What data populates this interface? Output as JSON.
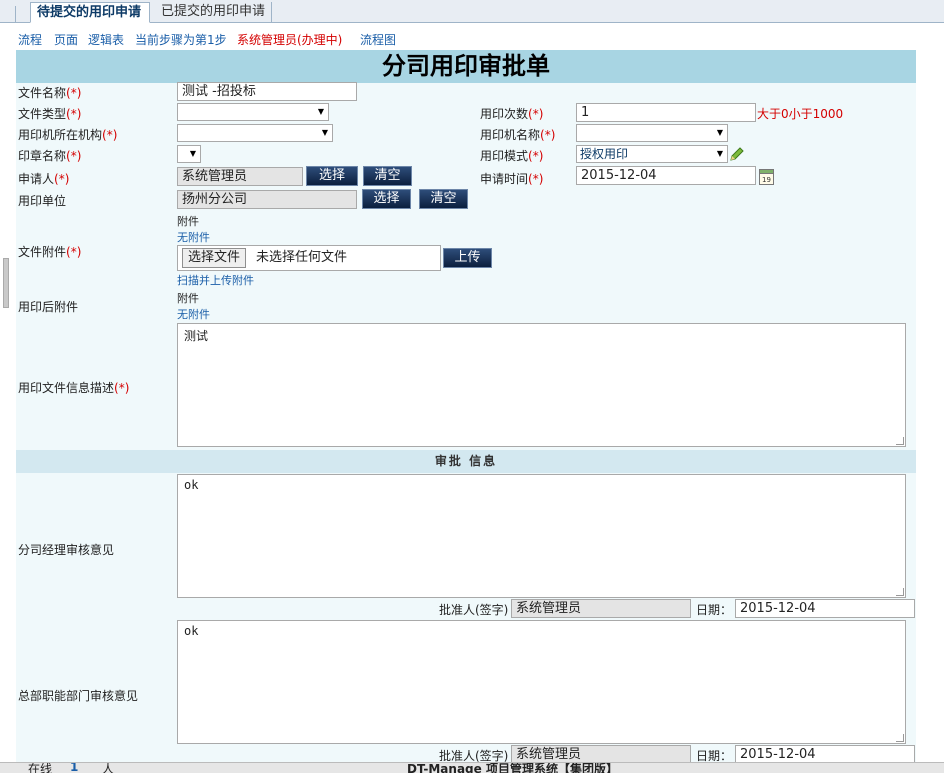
{
  "tabs": {
    "active": "待提交的用印申请",
    "inactive": "已提交的用印申请"
  },
  "toolbar": {
    "flow": "流程",
    "page": "页面",
    "logic": "逻辑表",
    "step": "当前步骤为第1步",
    "handler": "系统管理员(办理中)",
    "flowchart": "流程图"
  },
  "form": {
    "title": "分司用印审批单",
    "file_name": {
      "label": "文件名称",
      "value": "测试 -招投标"
    },
    "file_type": {
      "label": "文件类型",
      "value": ""
    },
    "use_count": {
      "label": "用印次数",
      "value": "1",
      "hint": "大于0小于1000"
    },
    "machine_org": {
      "label": "用印机所在机构",
      "value": ""
    },
    "machine_name": {
      "label": "用印机名称",
      "value": ""
    },
    "seal_name": {
      "label": "印章名称",
      "value": ""
    },
    "mode": {
      "label": "用印模式",
      "value": "授权用印"
    },
    "applicant": {
      "label": "申请人",
      "value": "系统管理员"
    },
    "apply_time": {
      "label": "申请时间",
      "value": "2015-12-04"
    },
    "unit": {
      "label": "用印单位",
      "value": "扬州分公司"
    },
    "select_label": "选择",
    "clear_label": "清空",
    "attachment": {
      "label": "文件附件",
      "caption": "附件",
      "none": "无附件",
      "choose": "选择文件",
      "no_file": "未选择任何文件",
      "upload": "上传",
      "scan": "扫描并上传附件"
    },
    "after_attachment": {
      "label": "用印后附件",
      "caption": "附件",
      "none": "无附件"
    },
    "description": {
      "label": "用印文件信息描述",
      "value": "测试"
    },
    "req_mark": "(*)"
  },
  "approval": {
    "section_title": "审批 信息",
    "branch": {
      "label": "分司经理审核意见",
      "opinion": "ok",
      "approver_label": "批准人(签字)",
      "approver": "系统管理员",
      "date_label": "日期：",
      "date": "2015-12-04"
    },
    "hq": {
      "label": "总部职能部门审核意见",
      "opinion": "ok",
      "approver_label": "批准人(签字)",
      "approver": "系统管理员",
      "date_label": "日期：",
      "date": "2015-12-04"
    }
  },
  "status": {
    "online": "在线",
    "count": "1",
    "unit": "人",
    "system": "DT-Manage 项目管理系统【集团版】"
  }
}
